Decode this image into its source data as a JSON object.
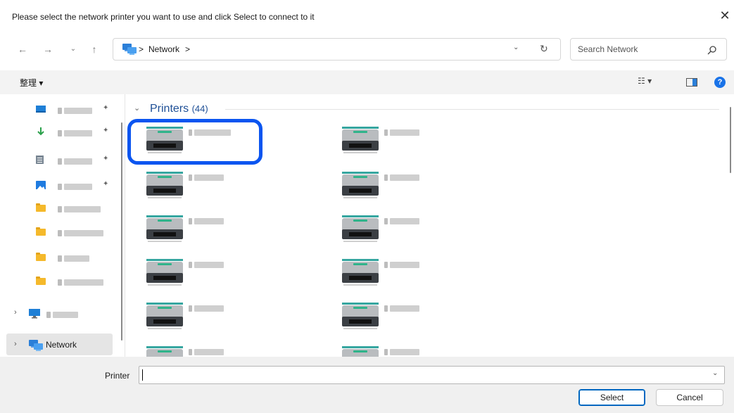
{
  "window": {
    "title": "Please select the network printer you want to use and click Select to connect to it",
    "close_icon": "close-icon"
  },
  "navigation": {
    "back_icon": "back-arrow-icon",
    "forward_icon": "forward-arrow-icon",
    "recent_icon": "chevron-down-icon",
    "up_icon": "up-arrow-icon",
    "breadcrumb_sep_1": ">",
    "breadcrumb_network": "Network",
    "breadcrumb_sep_2": ">",
    "refresh_icon": "refresh-icon",
    "search_placeholder": "Search Network",
    "search_icon": "search-icon"
  },
  "toolbar": {
    "organize_label": "整理 ▾",
    "view_icon": "view-options-icon",
    "preview_icon": "preview-pane-icon",
    "help_icon": "help-icon"
  },
  "sidebar": {
    "items": [
      {
        "icon": "desktop-icon",
        "pinned": true
      },
      {
        "icon": "download-icon",
        "pinned": true
      },
      {
        "icon": "document-icon",
        "pinned": true
      },
      {
        "icon": "pictures-icon",
        "pinned": true
      },
      {
        "icon": "folder-icon",
        "pinned": false
      },
      {
        "icon": "folder-icon",
        "pinned": false
      },
      {
        "icon": "folder-icon",
        "pinned": false
      },
      {
        "icon": "folder-icon",
        "pinned": false
      }
    ],
    "this_pc": {
      "icon": "monitor-icon"
    },
    "network": {
      "label": "Network",
      "icon": "network-icon"
    }
  },
  "content": {
    "group_label": "Printers",
    "group_count": "(44)"
  },
  "bottom": {
    "printer_label": "Printer",
    "printer_value": "",
    "select_label": "Select",
    "cancel_label": "Cancel"
  },
  "colors": {
    "accent": "#0067c0",
    "highlight_outline": "#0b55f0",
    "selected_bg": "#e5e5e5"
  }
}
